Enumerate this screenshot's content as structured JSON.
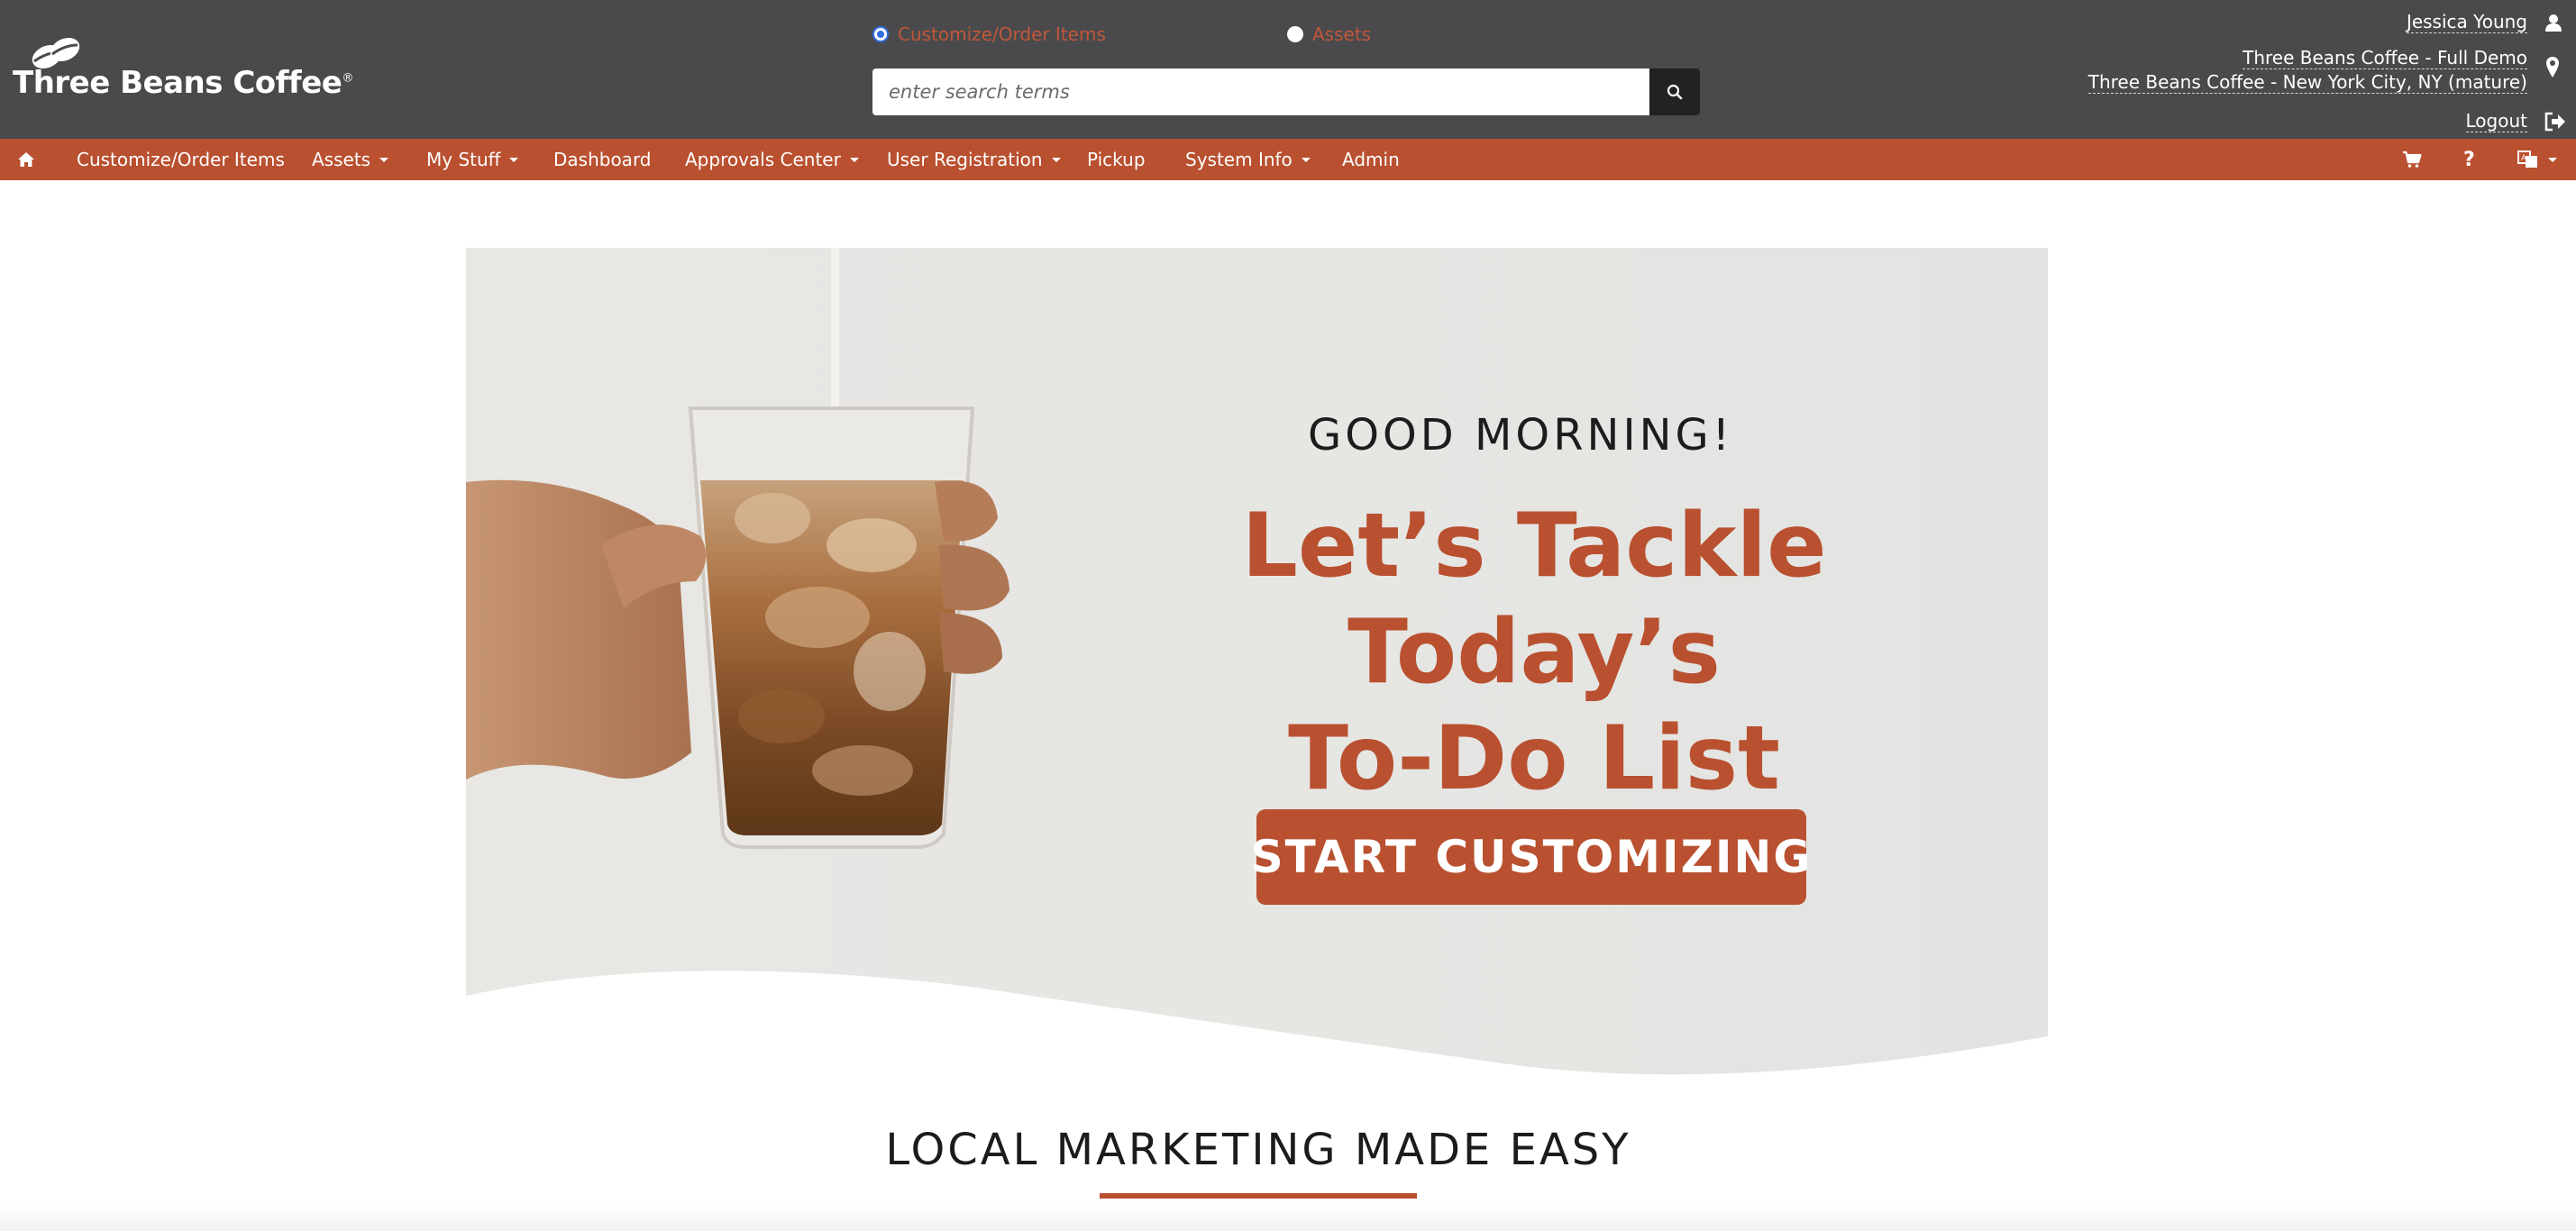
{
  "header": {
    "logo_text": "Three Beans Coffee",
    "logo_mark": "®",
    "search_mode_options": [
      {
        "label": "Customize/Order Items",
        "checked": true
      },
      {
        "label": "Assets",
        "checked": false
      }
    ],
    "search_placeholder": "enter search terms",
    "user_name": "Jessica Young",
    "account_name": "Three Beans Coffee - Full Demo",
    "location_name": "Three Beans Coffee - New York City, NY (mature)",
    "logout_label": "Logout"
  },
  "nav": {
    "items": [
      {
        "label": "Customize/Order Items",
        "dropdown": false
      },
      {
        "label": "Assets",
        "dropdown": true
      },
      {
        "label": "My Stuff",
        "dropdown": true
      },
      {
        "label": "Dashboard",
        "dropdown": false
      },
      {
        "label": "Approvals Center",
        "dropdown": true
      },
      {
        "label": "User Registration",
        "dropdown": true
      },
      {
        "label": "Pickup",
        "dropdown": false
      },
      {
        "label": "System Info",
        "dropdown": true
      },
      {
        "label": "Admin",
        "dropdown": false
      }
    ],
    "right_icons": [
      "cart-icon",
      "help-icon",
      "language-icon"
    ]
  },
  "hero": {
    "greeting": "GOOD MORNING!",
    "headline_line1": "Let’s Tackle Today’s",
    "headline_line2": "To-Do List",
    "cta_label": "START CUSTOMIZING"
  },
  "section": {
    "title": "LOCAL MARKETING MADE EASY"
  },
  "colors": {
    "header_bg": "#4a4a4c",
    "nav_bg": "#b9502f",
    "accent": "#b9502f",
    "radio_selected": "#2f6de1"
  }
}
